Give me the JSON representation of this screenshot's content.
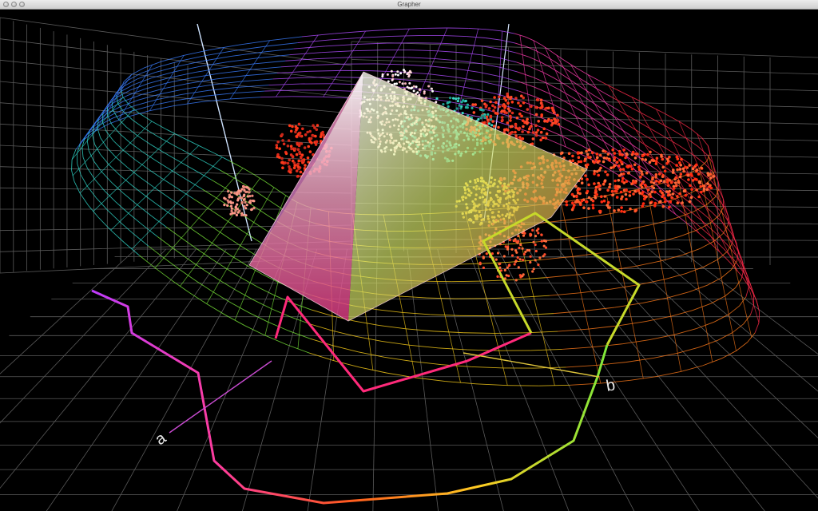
{
  "window": {
    "title": "Grapher",
    "buttons": [
      "close-button",
      "minimize-button",
      "zoom-button"
    ]
  },
  "plot": {
    "type": "3d-scatter-wireframe",
    "axis_labels": {
      "a": "a",
      "b": "b"
    },
    "colors": {
      "background": "#000000",
      "grid": "#6a6a6a",
      "magenta": "#d23bd6",
      "red": "#ff3a1a",
      "yellow": "#ffd21a",
      "green": "#2ee06a",
      "cyan": "#2fd6c8",
      "blue": "#2c5cff"
    }
  }
}
